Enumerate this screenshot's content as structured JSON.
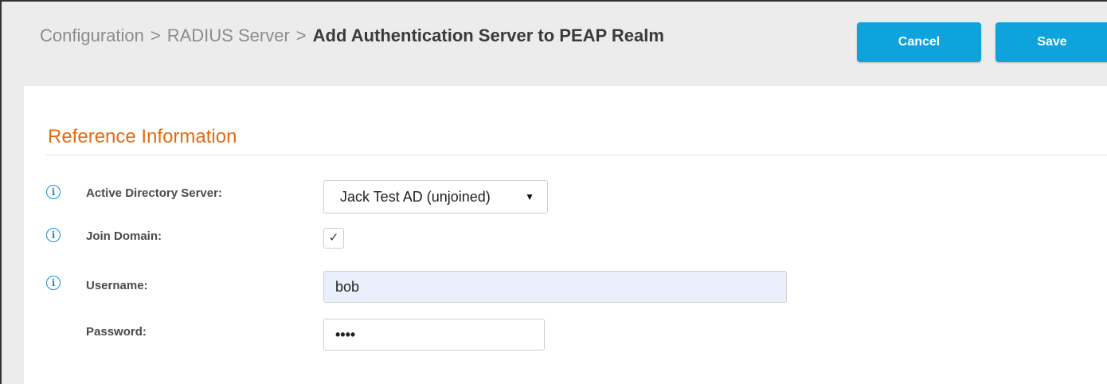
{
  "breadcrumb": {
    "items": [
      "Configuration",
      "RADIUS Server"
    ],
    "separator": ">",
    "current": "Add Authentication Server to PEAP Realm"
  },
  "toolbar": {
    "cancel_label": "Cancel",
    "save_label": "Save"
  },
  "section": {
    "title": "Reference Information"
  },
  "form": {
    "ad_server": {
      "label": "Active Directory Server:",
      "value": "Jack Test AD (unjoined)",
      "arrow": "▼"
    },
    "join_domain": {
      "label": "Join Domain:",
      "checked_mark": "✓"
    },
    "username": {
      "label": "Username:",
      "value": "bob"
    },
    "password": {
      "label": "Password:",
      "value": "••••"
    }
  },
  "icons": {
    "info": "i"
  },
  "colors": {
    "accent": "#0ea3dc",
    "section_title": "#e36b12",
    "info_icon": "#1a8fd6"
  }
}
